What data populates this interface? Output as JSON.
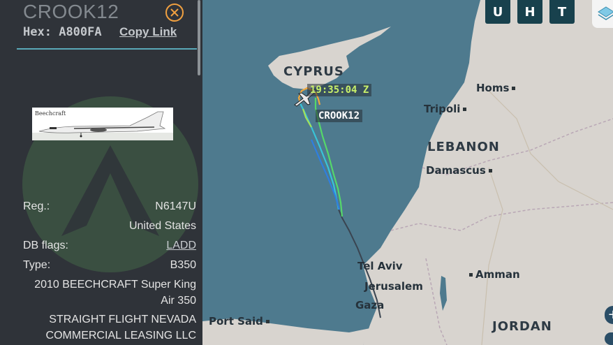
{
  "panel": {
    "callsign": "CROOK12",
    "hex_label": "Hex:",
    "hex": "A800FA",
    "copy_link": "Copy Link",
    "reg_label": "Reg.:",
    "reg": "N6147U",
    "country": "United States",
    "db_flags_label": "DB flags:",
    "db_flags": "LADD",
    "type_label": "Type:",
    "type": "B350",
    "description_line1": "2010 BEECHCRAFT Super King",
    "description_line2": "Air 350",
    "owner_line1": "STRAIGHT FLIGHT NEVADA",
    "owner_line2": "COMMERCIAL LEASING LLC",
    "photo_caption": "Beechcraft"
  },
  "map": {
    "buttons": {
      "u": "U",
      "h": "H",
      "t": "T"
    },
    "places": {
      "cyprus": "CYPRUS",
      "homs": "Homs",
      "tripoli": "Tripoli",
      "lebanon": "LEBANON",
      "damascus": "Damascus",
      "tel_aviv": "Tel Aviv",
      "jerusalem": "Jerusalem",
      "amman": "Amman",
      "gaza": "Gaza",
      "port_said": "Port Said",
      "jordan": "JORDAN"
    },
    "aircraft_callsign_label": "CROOK12",
    "aircraft_time_label": "19:35:04 Z"
  },
  "colors": {
    "panel_bg": "#2f3339",
    "sea": "#4e7a8e",
    "land": "#d8d4cf",
    "accent_divider": "#5aa9b9",
    "button_bg": "#18414d",
    "time_label": "#c8f06a"
  }
}
